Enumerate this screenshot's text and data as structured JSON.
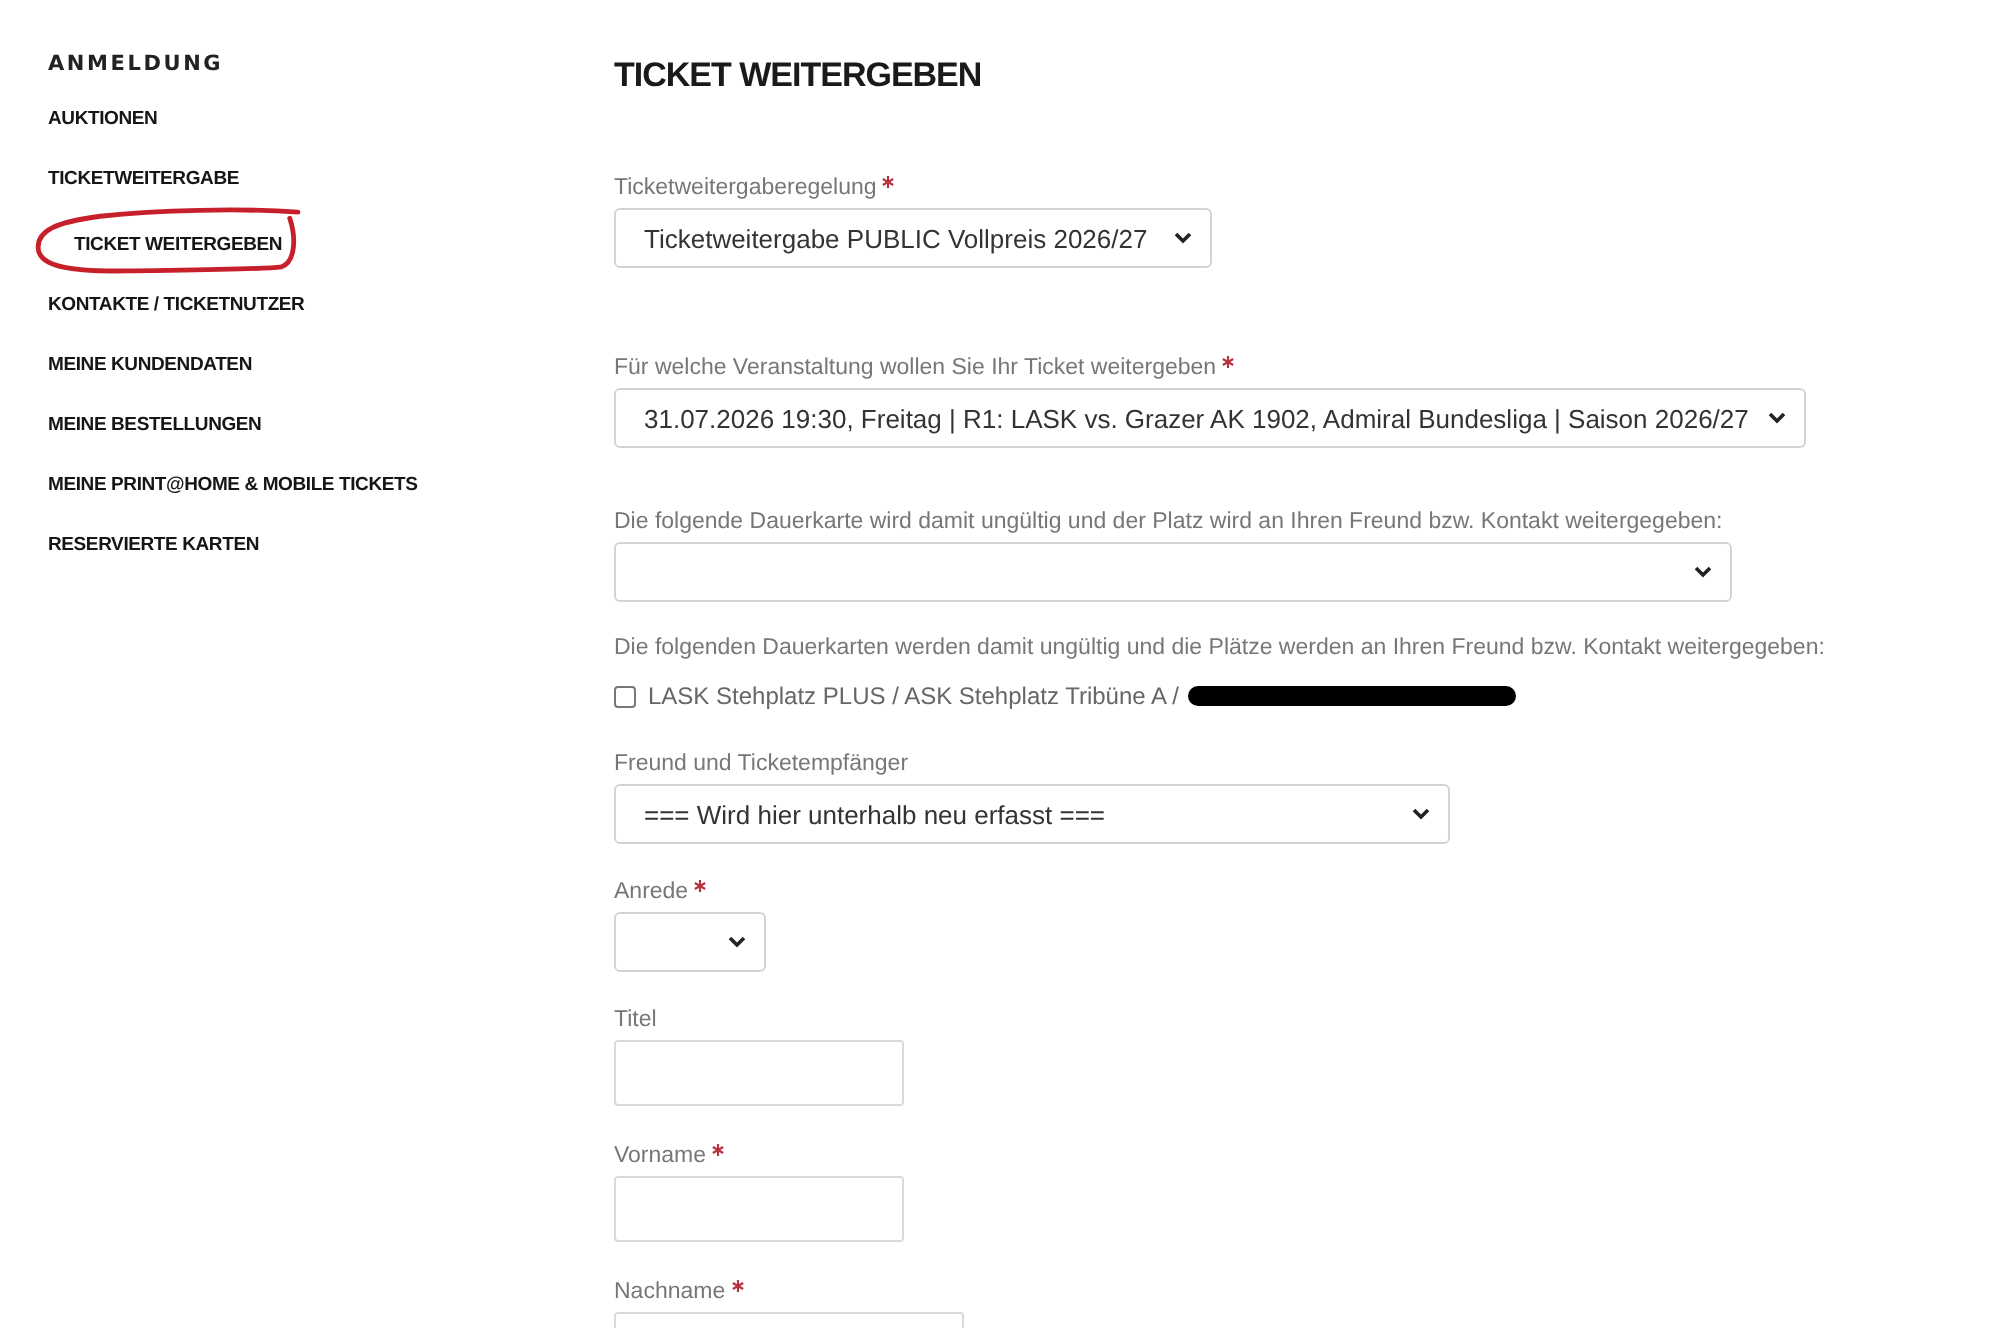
{
  "sidebar": {
    "heading": "ANMELDUNG",
    "items": [
      {
        "label": "AUKTIONEN",
        "circled": false
      },
      {
        "label": "TICKETWEITERGABE",
        "circled": false,
        "children": [
          {
            "label": "TICKET WEITERGEBEN",
            "circled": true
          }
        ]
      },
      {
        "label": "KONTAKTE / TICKETNUTZER",
        "circled": false
      },
      {
        "label": "MEINE KUNDENDATEN",
        "circled": false
      },
      {
        "label": "MEINE BESTELLUNGEN",
        "circled": false
      },
      {
        "label": "MEINE PRINT@HOME & MOBILE TICKETS",
        "circled": false
      },
      {
        "label": "RESERVIERTE KARTEN",
        "circled": false
      }
    ]
  },
  "main": {
    "title": "TICKET WEITERGEBEN",
    "fields": [
      {
        "kind": "select",
        "label": "Ticketweitergaberegelung",
        "required": true,
        "value": "Ticketweitergabe PUBLIC Vollpreis 2026/27"
      },
      {
        "kind": "select",
        "label": "Für welche Veranstaltung wollen Sie Ihr Ticket weitergeben",
        "required": true,
        "value": "31.07.2026 19:30, Freitag | R1: LASK vs. Grazer AK 1902, Admiral Bundesliga | Saison 2026/27"
      },
      {
        "kind": "select",
        "label": "Die folgende Dauerkarte wird damit ungültig und der Platz wird an Ihren Freund bzw. Kontakt weitergegeben:",
        "required": false
      },
      {
        "kind": "checkboxes",
        "label": "Die folgenden Dauerkarten werden damit ungültig und die Plätze werden an Ihren Freund bzw. Kontakt weitergegeben:",
        "required": false,
        "options": [
          {
            "label": "LASK Stehplatz PLUS / ASK Stehplatz Tribüne A /",
            "checked": false,
            "redacted": true
          }
        ]
      },
      {
        "kind": "select",
        "label": "Freund und Ticketempfänger",
        "required": false,
        "value": "=== Wird hier unterhalb neu erfasst ==="
      },
      {
        "kind": "select",
        "label": "Anrede",
        "required": true
      },
      {
        "kind": "input",
        "label": "Titel",
        "required": false
      },
      {
        "kind": "input",
        "label": "Vorname",
        "required": true
      },
      {
        "kind": "input",
        "label": "Nachname",
        "required": true
      }
    ]
  }
}
